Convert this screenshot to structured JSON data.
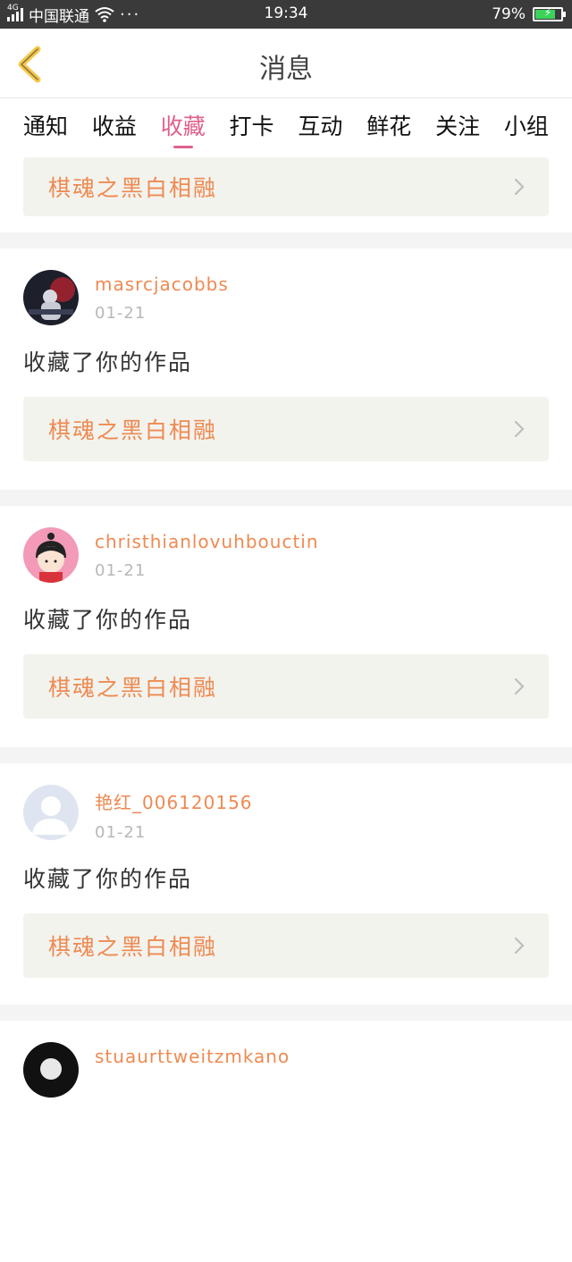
{
  "status_bar": {
    "network": "4G",
    "carrier": "中国联通",
    "more": "···",
    "time": "19:34",
    "battery_percent": "79%",
    "battery_level": 0.79
  },
  "header": {
    "title": "消息"
  },
  "tabs": [
    {
      "label": "通知",
      "active": false
    },
    {
      "label": "收益",
      "active": false
    },
    {
      "label": "收藏",
      "active": true
    },
    {
      "label": "打卡",
      "active": false
    },
    {
      "label": "互动",
      "active": false
    },
    {
      "label": "鲜花",
      "active": false
    },
    {
      "label": "关注",
      "active": false
    },
    {
      "label": "小组",
      "active": false
    }
  ],
  "top_partial": {
    "work_title": "棋魂之黑白相融"
  },
  "items": [
    {
      "username": "masrcjacobbs",
      "date": "01-21",
      "action": "收藏了你的作品",
      "work_title": "棋魂之黑白相融"
    },
    {
      "username": "christhianlovuhbouctin",
      "date": "01-21",
      "action": "收藏了你的作品",
      "work_title": "棋魂之黑白相融"
    },
    {
      "username": "艳红_006120156",
      "date": "01-21",
      "action": "收藏了你的作品",
      "work_title": "棋魂之黑白相融"
    },
    {
      "username": "stuaurttweitzmkano",
      "date": "",
      "action": "",
      "work_title": ""
    }
  ],
  "colors": {
    "accent_pink": "#e0608e",
    "username_orange": "#ee8a52",
    "back_yellow": "#f5c84a",
    "battery_green": "#3bd35a"
  }
}
